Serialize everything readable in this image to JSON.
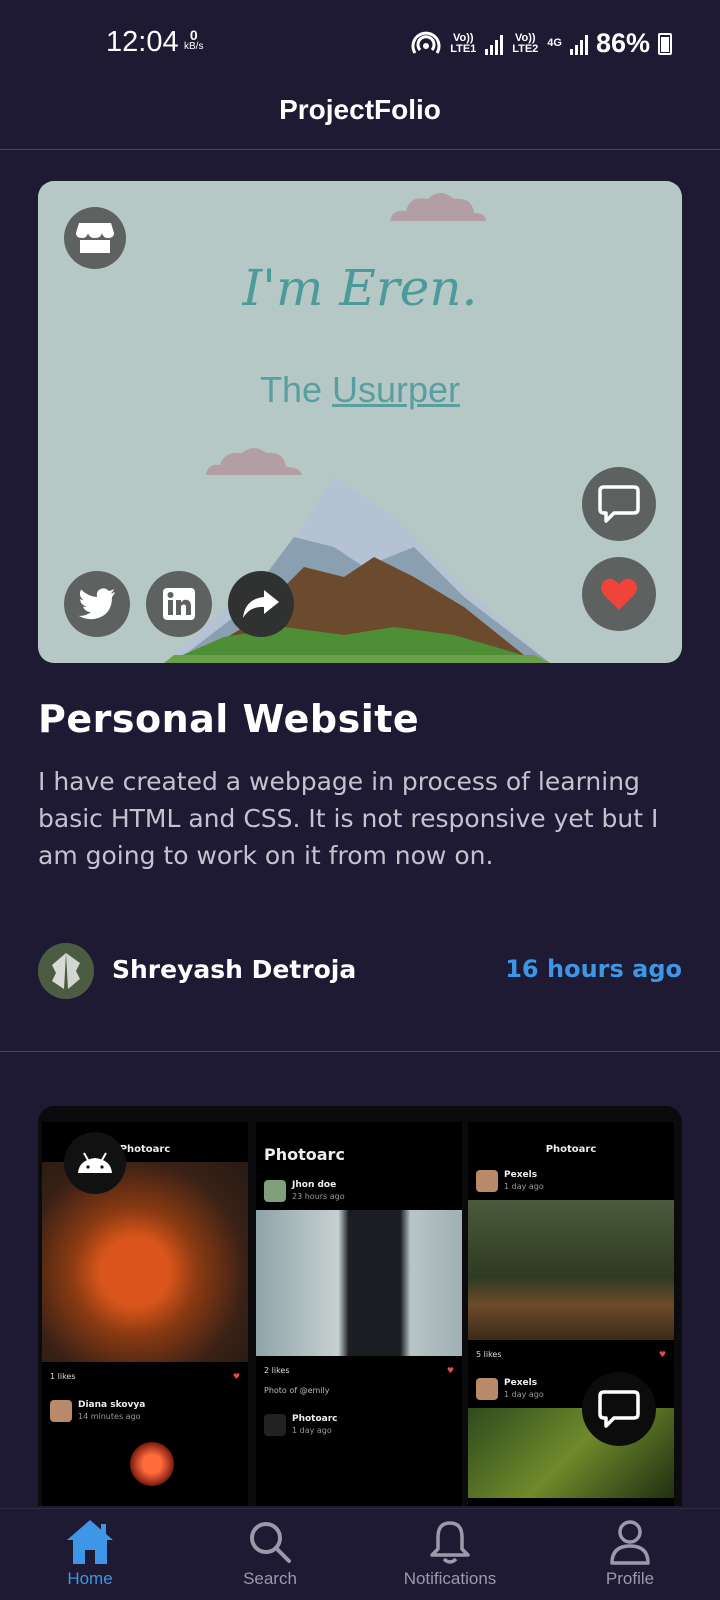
{
  "status_bar": {
    "time": "12:04",
    "net_speed_value": "0",
    "net_speed_unit": "kB/s",
    "sim1_label": "Vo)) LTE1",
    "sim2_label": "Vo)) LTE2",
    "network_type": "4G",
    "battery": "86%"
  },
  "app": {
    "title": "ProjectFolio"
  },
  "posts": [
    {
      "hero_title": "I'm Eren.",
      "hero_sub_prefix": "The ",
      "hero_sub_link": "Usurper",
      "title": "Personal Website",
      "description": "I have created a webpage in process of learning basic HTML and CSS. It is not responsive yet but I am going to work on it from now on.",
      "author": "Shreyash Detroja",
      "time": "16 hours ago"
    },
    {
      "screens": [
        {
          "app_title": "Photoarc",
          "likes": "1 likes",
          "user": "Diana skovya",
          "user_time": "14 minutes ago"
        },
        {
          "app_title": "Photoarc",
          "user": "Jhon doe",
          "user_time": "23 hours ago",
          "likes": "2 likes",
          "caption": "Photo of @emily",
          "user2": "Photoarc",
          "user2_time": "1 day ago"
        },
        {
          "app_title": "Photoarc",
          "user": "Pexels",
          "user_time": "1 day ago",
          "likes": "5 likes",
          "user2": "Pexels",
          "user2_time": "1 day ago"
        }
      ]
    }
  ],
  "nav": {
    "home": "Home",
    "search": "Search",
    "notifications": "Notifications",
    "profile": "Profile"
  },
  "colors": {
    "background": "#1e1a33",
    "accent": "#3d96e6",
    "like": "#f0433a",
    "card_bg": "#b6c8c6"
  }
}
